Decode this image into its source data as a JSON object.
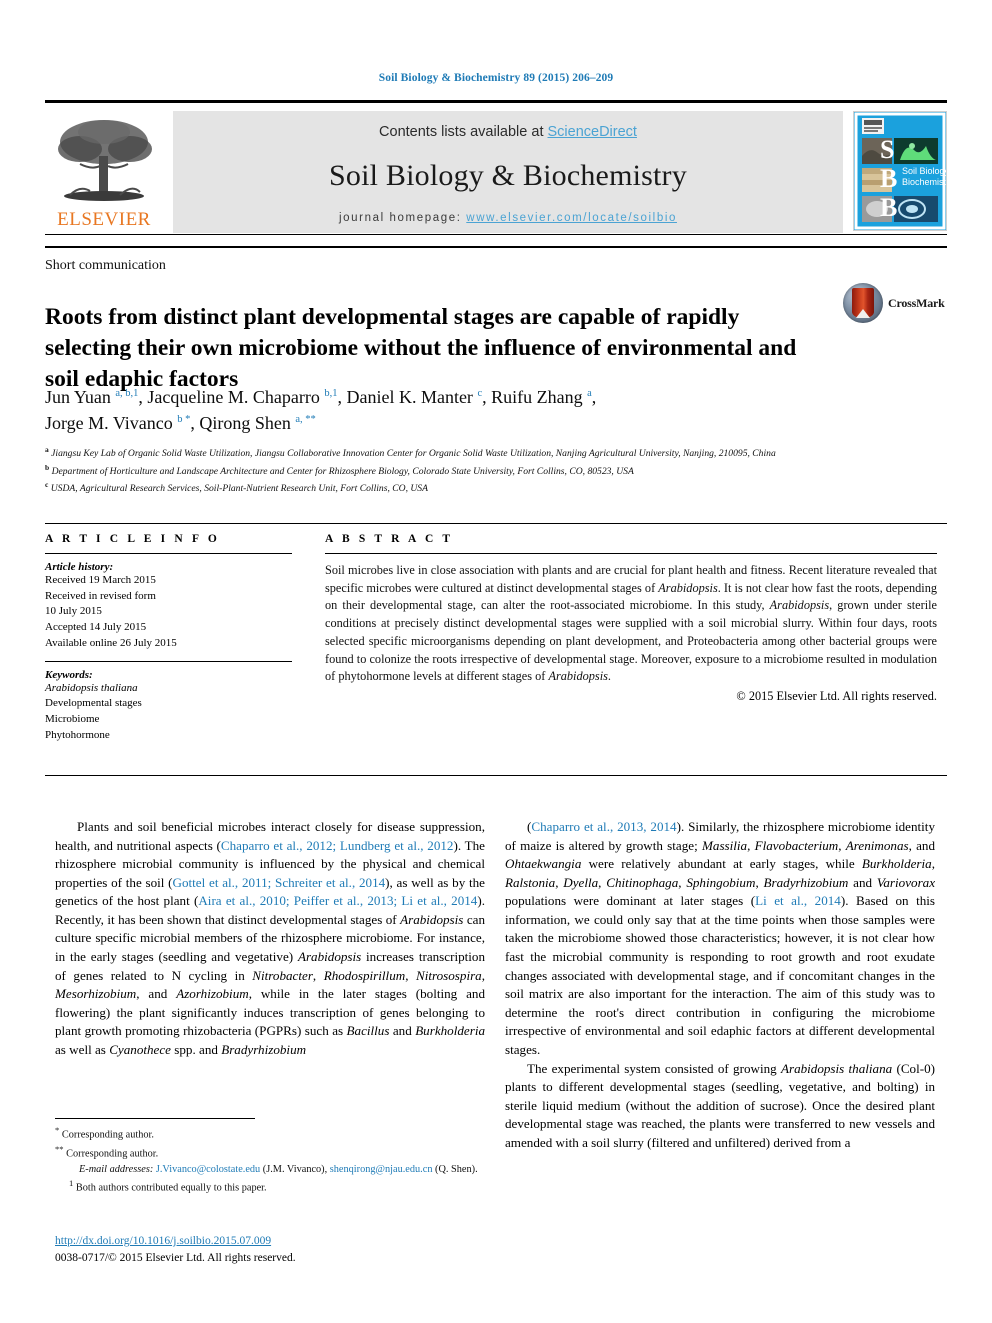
{
  "running_head": "Soil Biology & Biochemistry 89 (2015) 206–209",
  "masthead": {
    "publisher_name": "ELSEVIER",
    "contents_prefix": "Contents lists available at ",
    "contents_link": "ScienceDirect",
    "journal_title": "Soil Biology & Biochemistry",
    "homepage_prefix": "journal homepage: ",
    "homepage_url": "www.elsevier.com/locate/soilbio",
    "cover_letters": [
      "S",
      "B",
      "B"
    ],
    "cover_title": "Soil Biology & Biochemistry",
    "accent_blue": "#1f7bb6",
    "link_blue": "#4ba3d3",
    "elsevier_orange": "#E87722",
    "cover_blue": "#1ba1dd"
  },
  "article": {
    "section_type": "Short communication",
    "title": "Roots from distinct plant developmental stages are capable of rapidly selecting their own microbiome without the influence of environmental and soil edaphic factors",
    "crossmark_label": "CrossMark",
    "authors_line_1": "Jun Yuan <sup>a, b,1</sup>, Jacqueline M. Chaparro <sup>b,1</sup>, Daniel K. Manter <sup>c</sup>, Ruifu Zhang <sup>a</sup>,",
    "authors_line_2": "Jorge M. Vivanco <sup>b *</sup>, Qirong Shen <sup>a, **</sup>",
    "affiliations": [
      "<sup>a</sup> Jiangsu Key Lab of Organic Solid Waste Utilization, Jiangsu Collaborative Innovation Center for Organic Solid Waste Utilization, Nanjing Agricultural University, Nanjing, 210095, China",
      "<sup>b</sup> Department of Horticulture and Landscape Architecture and Center for Rhizosphere Biology, Colorado State University, Fort Collins, CO, 80523, USA",
      "<sup>c</sup> USDA, Agricultural Research Services, Soil-Plant-Nutrient Research Unit, Fort Collins, CO, USA"
    ]
  },
  "article_info": {
    "heading": "A R T I C L E   I N F O",
    "history_label": "Article history:",
    "history_lines": [
      "Received 19 March 2015",
      "Received in revised form",
      "10 July 2015",
      "Accepted 14 July 2015",
      "Available online 26 July 2015"
    ],
    "keywords_label": "Keywords:",
    "keywords": [
      "Arabidopsis thaliana",
      "Developmental stages",
      "Microbiome",
      "Phytohormone"
    ]
  },
  "abstract": {
    "heading": "A B S T R A C T",
    "text": "Soil microbes live in close association with plants and are crucial for plant health and fitness. Recent literature revealed that specific microbes were cultured at distinct developmental stages of <i>Arabidopsis</i>. It is not clear how fast the roots, depending on their developmental stage, can alter the root-associated microbiome. In this study, <i>Arabidopsis</i>, grown under sterile conditions at precisely distinct developmental stages were supplied with a soil microbial slurry. Within four days, roots selected specific microorganisms depending on plant development, and Proteobacteria among other bacterial groups were found to colonize the roots irrespective of developmental stage. Moreover, exposure to a microbiome resulted in modulation of phytohormone levels at different stages of <i>Arabidopsis</i>.",
    "copyright": "© 2015 Elsevier Ltd. All rights reserved."
  },
  "body": {
    "left_column": "Plants and soil beneficial microbes interact closely for disease suppression, health, and nutritional aspects (<a class=\"ref\" href=\"#\">Chaparro et al., 2012; Lundberg et al., 2012</a>). The rhizosphere microbial community is influenced by the physical and chemical properties of the soil (<a class=\"ref\" href=\"#\">Gottel et al., 2011; Schreiter et al., 2014</a>), as well as by the genetics of the host plant (<a class=\"ref\" href=\"#\">Aira et al., 2010; Peiffer et al., 2013; Li et al., 2014</a>). Recently, it has been shown that distinct developmental stages of <i>Arabidopsis</i> can culture specific microbial members of the rhizosphere microbiome. For instance, in the early stages (seedling and vegetative) <i>Arabidopsis</i> increases transcription of genes related to N cycling in <i>Nitrobacter</i>, <i>Rhodospirillum</i>, <i>Nitrosospira</i>, <i>Mesorhizobium</i>, and <i>Azorhizobium</i>, while in the later stages (bolting and flowering) the plant significantly induces transcription of genes belonging to plant growth promoting rhizobacteria (PGPRs) such as <i>Bacillus</i> and <i>Burkholderia</i> as well as <i>Cyanothece</i> spp. and <i>Bradyrhizobium</i>",
    "right_column_p1": "(<a class=\"ref\" href=\"#\">Chaparro et al., 2013, 2014</a>). Similarly, the rhizosphere microbiome identity of maize is altered by growth stage; <i>Massilia</i>, <i>Flavobacterium</i>, <i>Arenimonas</i>, and <i>Ohtaekwangia</i> were relatively abundant at early stages, while <i>Burkholderia</i>, <i>Ralstonia</i>, <i>Dyella</i>, <i>Chitinophaga</i>, <i>Sphingobium</i>, <i>Bradyrhizobium</i> and <i>Variovorax</i> populations were dominant at later stages (<a class=\"ref\" href=\"#\">Li et al., 2014</a>). Based on this information, we could only say that at the time points when those samples were taken the microbiome showed those characteristics; however, it is not clear how fast the microbial community is responding to root growth and root exudate changes associated with developmental stage, and if concomitant changes in the soil matrix are also important for the interaction. The aim of this study was to determine the root's direct contribution in configuring the microbiome irrespective of environmental and soil edaphic factors at different developmental stages.",
    "right_column_p2": "The experimental system consisted of growing <i>Arabidopsis thaliana</i> (Col-0) plants to different developmental stages (seedling, vegetative, and bolting) in sterile liquid medium (without the addition of sucrose). Once the desired plant developmental stage was reached, the plants were transferred to new vessels and amended with a soil slurry (filtered and unfiltered) derived from a"
  },
  "footnotes": {
    "line1": "<sup>*</sup> Corresponding author.",
    "line2": "<sup>**</sup> Corresponding author.",
    "line3": "<span class=\"ital\">E-mail addresses:</span> <a class=\"ref\" href=\"#\">J.Vivanco@colostate.edu</a> (J.M. Vivanco), <a class=\"ref\" href=\"#\">shenqirong@njau.edu.cn</a> (Q. Shen).",
    "line4": "<sup>1</sup> Both authors contributed equally to this paper.",
    "doi": "http://dx.doi.org/10.1016/j.soilbio.2015.07.009",
    "issn_line": "0038-0717/© 2015 Elsevier Ltd. All rights reserved."
  }
}
